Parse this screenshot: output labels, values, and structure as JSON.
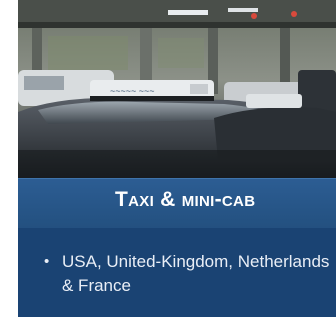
{
  "slide": {
    "title": "Taxi & mini-cab",
    "bullets": [
      {
        "marker": "•",
        "text": "USA, United-Kingdom, Netherlands & France"
      }
    ],
    "colors": {
      "band": "#2c5d93",
      "panel": "#1a4373",
      "text": "#ffffff"
    }
  },
  "photo": {
    "subject": "taxi cars with roof signs at a covered rank",
    "icons": [
      "taxi-roof-sign-icon"
    ]
  }
}
